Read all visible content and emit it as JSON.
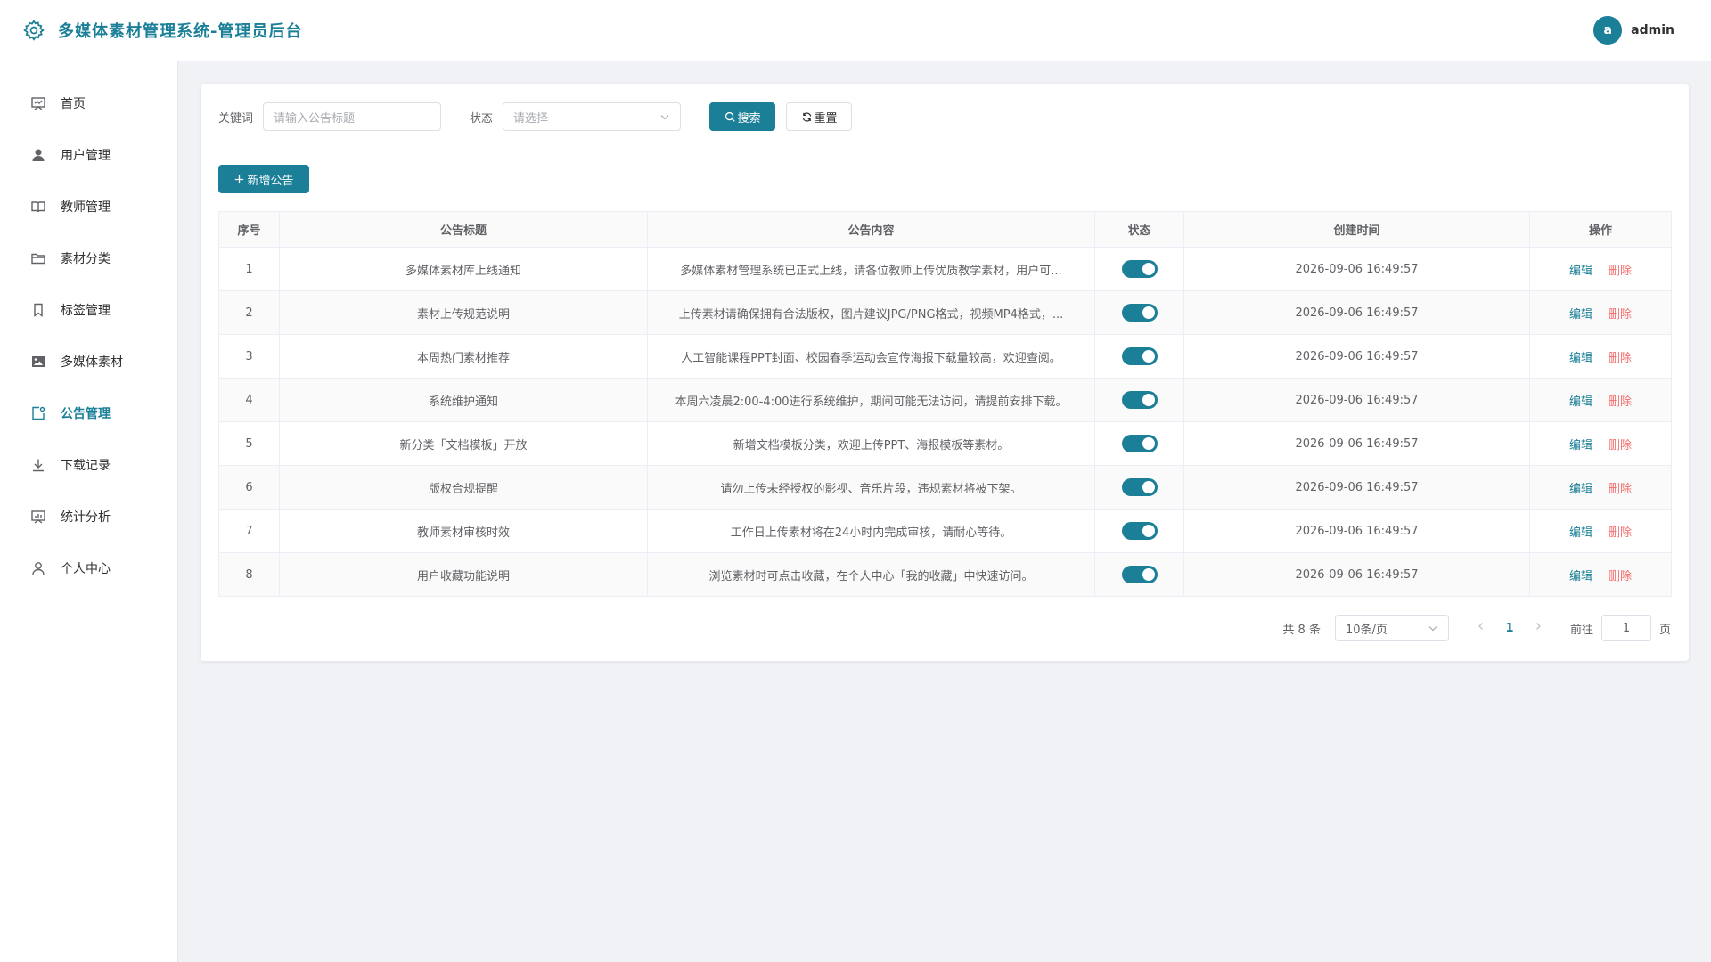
{
  "header": {
    "title": "多媒体素材管理系统-管理员后台",
    "avatar_letter": "a",
    "username": "admin",
    "accent": "#1a7f97"
  },
  "sidebar": {
    "items": [
      {
        "label": "首页",
        "icon": "home-screen-icon",
        "active": false
      },
      {
        "label": "用户管理",
        "icon": "user-icon",
        "active": false
      },
      {
        "label": "教师管理",
        "icon": "book-icon",
        "active": false
      },
      {
        "label": "素材分类",
        "icon": "folder-icon",
        "active": false
      },
      {
        "label": "标签管理",
        "icon": "bookmark-icon",
        "active": false
      },
      {
        "label": "多媒体素材",
        "icon": "image-icon",
        "active": false
      },
      {
        "label": "公告管理",
        "icon": "notice-icon",
        "active": true
      },
      {
        "label": "下载记录",
        "icon": "download-icon",
        "active": false
      },
      {
        "label": "统计分析",
        "icon": "chart-icon",
        "active": false
      },
      {
        "label": "个人中心",
        "icon": "user-outline-icon",
        "active": false
      }
    ]
  },
  "filter": {
    "keyword_label": "关键词",
    "keyword_placeholder": "请输入公告标题",
    "status_label": "状态",
    "status_placeholder": "请选择",
    "search_label": "搜索",
    "reset_label": "重置"
  },
  "add_button_label": "新增公告",
  "table": {
    "headers": [
      "序号",
      "公告标题",
      "公告内容",
      "状态",
      "创建时间",
      "操作"
    ],
    "edit_label": "编辑",
    "delete_label": "删除",
    "rows": [
      {
        "no": "1",
        "title": "多媒体素材库上线通知",
        "content": "多媒体素材管理系统已正式上线，请各位教师上传优质教学素材，用户可...",
        "enabled": true,
        "created": "2026-09-06 16:49:57"
      },
      {
        "no": "2",
        "title": "素材上传规范说明",
        "content": "上传素材请确保拥有合法版权，图片建议JPG/PNG格式，视频MP4格式，...",
        "enabled": true,
        "created": "2026-09-06 16:49:57"
      },
      {
        "no": "3",
        "title": "本周热门素材推荐",
        "content": "人工智能课程PPT封面、校园春季运动会宣传海报下载量较高，欢迎查阅。",
        "enabled": true,
        "created": "2026-09-06 16:49:57"
      },
      {
        "no": "4",
        "title": "系统维护通知",
        "content": "本周六凌晨2:00-4:00进行系统维护，期间可能无法访问，请提前安排下载。",
        "enabled": true,
        "created": "2026-09-06 16:49:57"
      },
      {
        "no": "5",
        "title": "新分类「文档模板」开放",
        "content": "新增文档模板分类，欢迎上传PPT、海报模板等素材。",
        "enabled": true,
        "created": "2026-09-06 16:49:57"
      },
      {
        "no": "6",
        "title": "版权合规提醒",
        "content": "请勿上传未经授权的影视、音乐片段，违规素材将被下架。",
        "enabled": true,
        "created": "2026-09-06 16:49:57"
      },
      {
        "no": "7",
        "title": "教师素材审核时效",
        "content": "工作日上传素材将在24小时内完成审核，请耐心等待。",
        "enabled": true,
        "created": "2026-09-06 16:49:57"
      },
      {
        "no": "8",
        "title": "用户收藏功能说明",
        "content": "浏览素材时可点击收藏，在个人中心「我的收藏」中快速访问。",
        "enabled": true,
        "created": "2026-09-06 16:49:57"
      }
    ]
  },
  "pagination": {
    "total": "共 8 条",
    "page_size": "10条/页",
    "current_page": "1",
    "goto_label": "前往",
    "goto_value": "1",
    "page_suffix": "页"
  }
}
